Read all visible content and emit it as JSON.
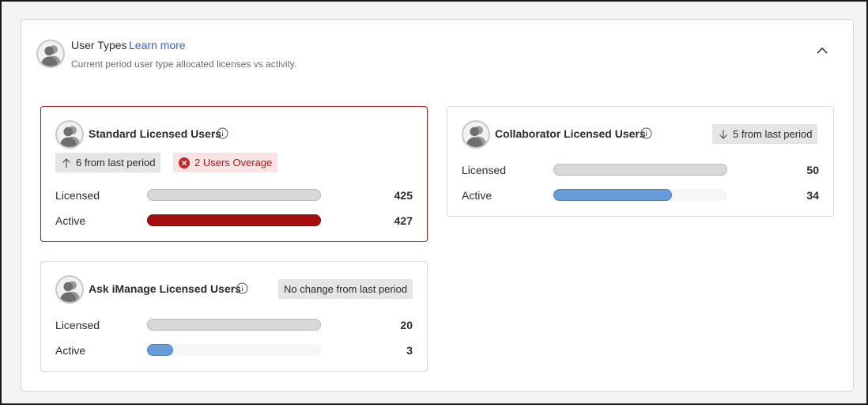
{
  "section": {
    "title": "User Types",
    "learn_more": "Learn more",
    "subtitle": "Current period user type allocated licenses vs activity."
  },
  "icons": {
    "avatar": "user-group-icon",
    "info": "info-icon",
    "collapse": "chevron-up-icon",
    "up": "arrow-up-icon",
    "down": "arrow-down-icon",
    "error": "error-circle-icon"
  },
  "colors": {
    "alert_border": "#a31a1a",
    "overage_bar": "#a30f0f",
    "active_bar": "#669dd9",
    "licensed_bar": "#d8d8d8",
    "link": "#3b5fc5"
  },
  "cards": {
    "standard": {
      "title": "Standard Licensed Users",
      "trend": "6 from last period",
      "trend_direction": "up",
      "overage": "2 Users Overage",
      "licensed_label": "Licensed",
      "licensed_value": "425",
      "active_label": "Active",
      "active_value": "427",
      "licensed_fill": 1.0,
      "active_fill": 1.0
    },
    "collaborator": {
      "title": "Collaborator Licensed Users",
      "trend": "5 from last period",
      "trend_direction": "down",
      "licensed_label": "Licensed",
      "licensed_value": "50",
      "active_label": "Active",
      "active_value": "34",
      "licensed_fill": 1.0,
      "active_fill": 0.68
    },
    "ask": {
      "title": "Ask iManage Licensed Users",
      "trend": "No change from last period",
      "licensed_label": "Licensed",
      "licensed_value": "20",
      "active_label": "Active",
      "active_value": "3",
      "licensed_fill": 1.0,
      "active_fill": 0.15
    }
  }
}
